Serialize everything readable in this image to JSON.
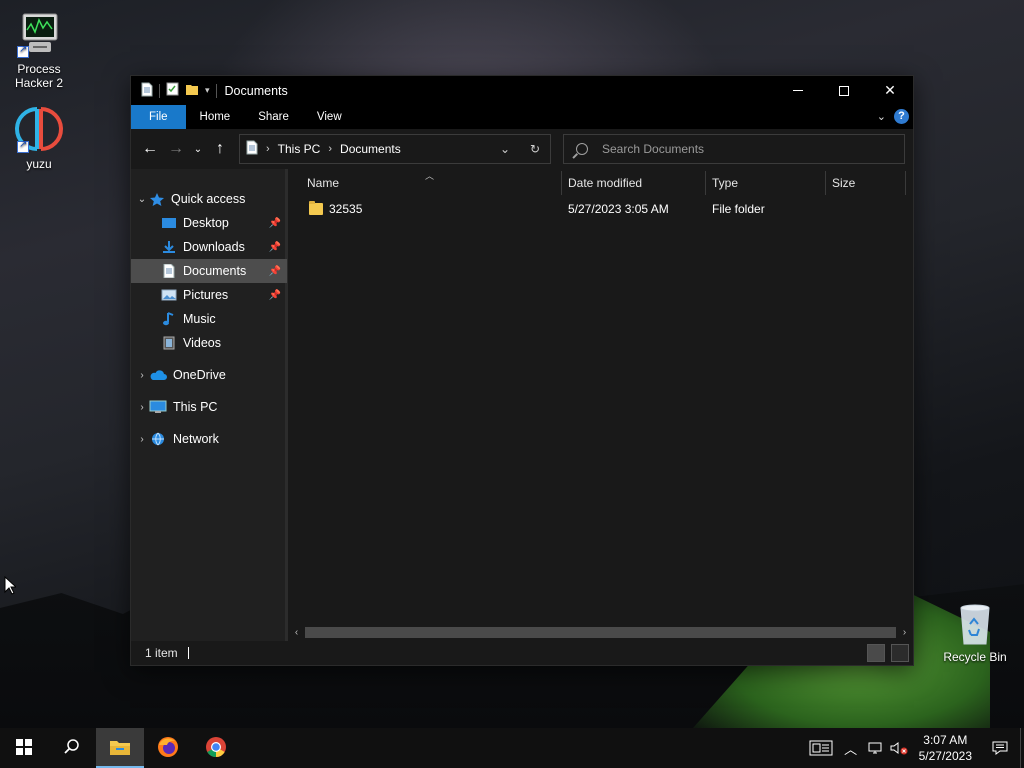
{
  "desktop": {
    "icons": [
      {
        "label_line1": "Process",
        "label_line2": "Hacker 2",
        "icon": "process-hacker-icon"
      },
      {
        "label_line1": "yuzu",
        "label_line2": "",
        "icon": "yuzu-icon"
      },
      {
        "label_line1": "Recycle Bin",
        "label_line2": "",
        "icon": "recycle-bin-icon"
      }
    ]
  },
  "window": {
    "title": "Documents",
    "controls": {
      "minimize": "—",
      "maximize": "☐",
      "close": "✕"
    }
  },
  "ribbon": {
    "tabs": [
      "File",
      "Home",
      "Share",
      "View"
    ],
    "help": "?"
  },
  "address_bar": {
    "crumbs": [
      "This PC",
      "Documents"
    ]
  },
  "search": {
    "placeholder": "Search Documents"
  },
  "nav_pane": {
    "quick_access": "Quick access",
    "items": [
      {
        "label": "Desktop",
        "pinned": true
      },
      {
        "label": "Downloads",
        "pinned": true
      },
      {
        "label": "Documents",
        "pinned": true,
        "selected": true
      },
      {
        "label": "Pictures",
        "pinned": true
      },
      {
        "label": "Music",
        "pinned": false
      },
      {
        "label": "Videos",
        "pinned": false
      }
    ],
    "roots": [
      "OneDrive",
      "This PC",
      "Network"
    ]
  },
  "file_list": {
    "columns": [
      "Name",
      "Date modified",
      "Type",
      "Size"
    ],
    "rows": [
      {
        "name": "32535",
        "date_modified": "5/27/2023 3:05 AM",
        "type": "File folder",
        "size": ""
      }
    ]
  },
  "status": {
    "item_count": "1 item"
  },
  "taskbar": {
    "clock_time": "3:07 AM",
    "clock_date": "5/27/2023"
  },
  "colors": {
    "accent": "#1979ca",
    "folder": "#f4c94f",
    "window_bg": "#191919",
    "titlebar_bg": "#000000"
  }
}
